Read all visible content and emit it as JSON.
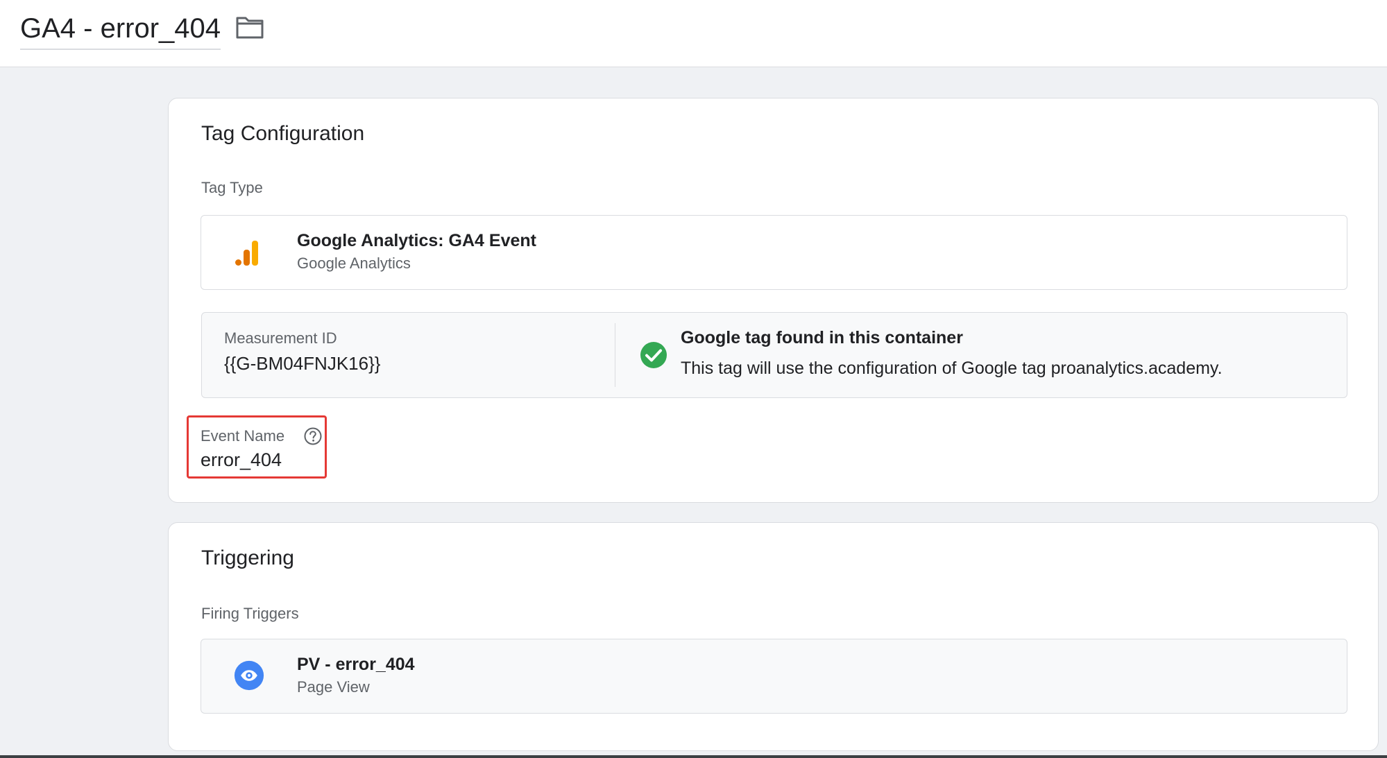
{
  "header": {
    "tag_name": "GA4 - error_404",
    "folder_icon": "folder-icon"
  },
  "tag_configuration": {
    "title": "Tag Configuration",
    "tag_type_label": "Tag Type",
    "tag_type": {
      "name": "Google Analytics: GA4 Event",
      "provider": "Google Analytics",
      "icon": "google-analytics-icon"
    },
    "measurement": {
      "label": "Measurement ID",
      "value": "{{G-BM04FNJK16}}"
    },
    "google_tag_status": {
      "icon": "check-circle-icon",
      "title": "Google tag found in this container",
      "description": "This tag will use the configuration of Google tag proanalytics.academy."
    },
    "event_name": {
      "label": "Event Name",
      "value": "error_404",
      "help_icon": "help-icon"
    }
  },
  "triggering": {
    "title": "Triggering",
    "firing_triggers_label": "Firing Triggers",
    "trigger": {
      "name": "PV - error_404",
      "type": "Page View",
      "icon": "eye-icon"
    }
  },
  "colors": {
    "background": "#eff1f4",
    "ga_orange": "#f9ab00",
    "ga_dark_orange": "#e37400",
    "success_green": "#34a853",
    "trigger_blue": "#4285f4",
    "highlight_red": "#e53935"
  }
}
